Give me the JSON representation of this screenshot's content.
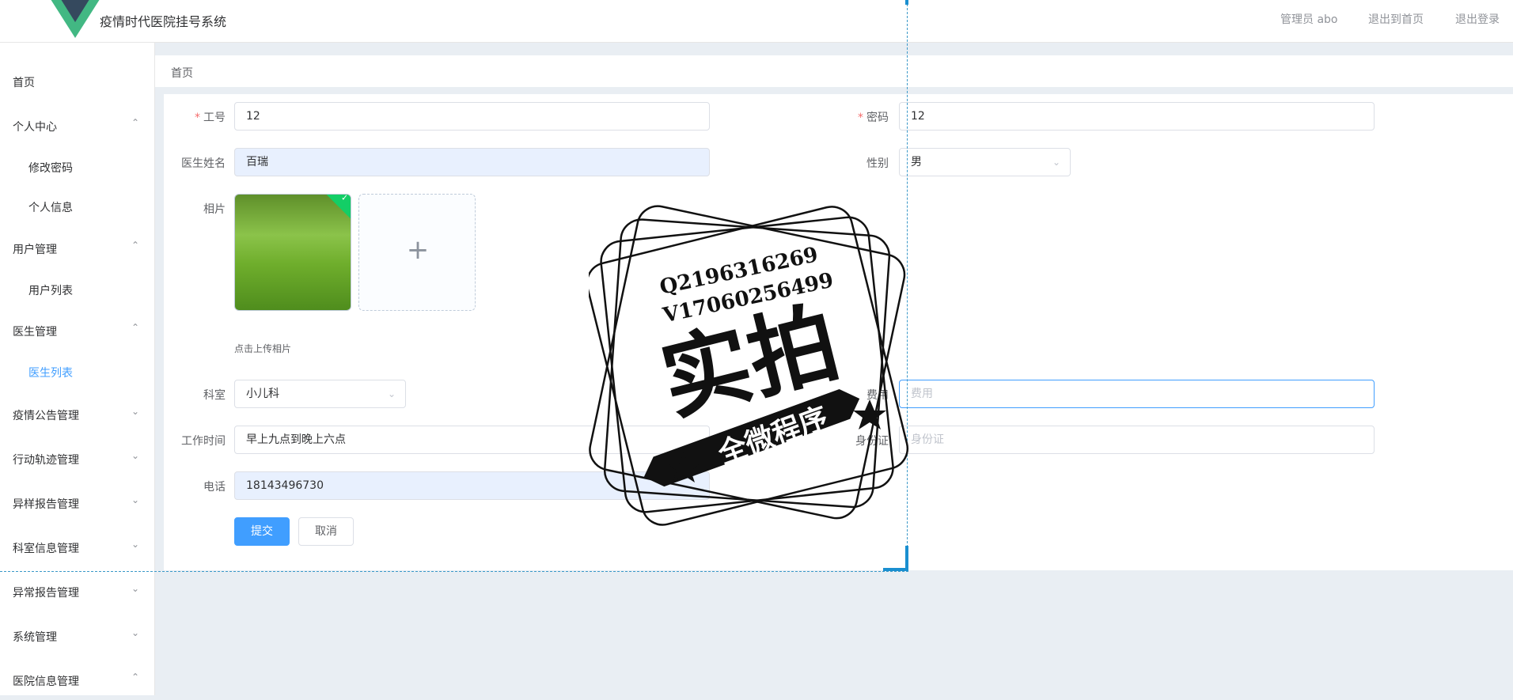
{
  "header": {
    "app_title": "疫情时代医院挂号系统",
    "admin_label": "管理员 abo",
    "back_home": "退出到首页",
    "logout": "退出登录"
  },
  "sidebar": {
    "items": [
      {
        "label": "首页",
        "type": "top",
        "arrow": ""
      },
      {
        "label": "个人中心",
        "type": "top",
        "arrow": "^"
      },
      {
        "label": "修改密码",
        "type": "sub",
        "arrow": ""
      },
      {
        "label": "个人信息",
        "type": "sub",
        "arrow": ""
      },
      {
        "label": "用户管理",
        "type": "top",
        "arrow": "^"
      },
      {
        "label": "用户列表",
        "type": "sub",
        "arrow": ""
      },
      {
        "label": "医生管理",
        "type": "top",
        "arrow": "^"
      },
      {
        "label": "医生列表",
        "type": "sub",
        "arrow": "",
        "active": true
      },
      {
        "label": "疫情公告管理",
        "type": "top",
        "arrow": "v"
      },
      {
        "label": "行动轨迹管理",
        "type": "top",
        "arrow": "v"
      },
      {
        "label": "异样报告管理",
        "type": "top",
        "arrow": "v"
      },
      {
        "label": "科室信息管理",
        "type": "top",
        "arrow": "v"
      },
      {
        "label": "异常报告管理",
        "type": "top",
        "arrow": "v"
      },
      {
        "label": "系统管理",
        "type": "top",
        "arrow": "v"
      },
      {
        "label": "医院信息管理",
        "type": "top",
        "arrow": "^"
      }
    ]
  },
  "breadcrumb": {
    "home": "首页"
  },
  "form": {
    "job_no": {
      "label": "工号",
      "value": "12"
    },
    "password": {
      "label": "密码",
      "value": "12"
    },
    "doctor_name": {
      "label": "医生姓名",
      "value": "百瑞"
    },
    "gender": {
      "label": "性别",
      "value": "男"
    },
    "photo": {
      "label": "相片",
      "hint": "点击上传相片",
      "plus": "+"
    },
    "department": {
      "label": "科室",
      "value": "小儿科"
    },
    "fee": {
      "label": "费用",
      "placeholder": "费用"
    },
    "work_time": {
      "label": "工作时间",
      "value": "早上九点到晚上六点"
    },
    "id_card": {
      "label": "身份证",
      "placeholder": "身份证"
    },
    "phone": {
      "label": "电话",
      "value": "18143496730"
    },
    "submit": "提交",
    "cancel": "取消"
  },
  "watermark": {
    "line1": "Q2196316269",
    "line2": "V17060256499",
    "main": "实拍",
    "banner": "全微程序"
  },
  "colors": {
    "primary": "#409eff",
    "required": "#f56c6c",
    "success": "#13ce66",
    "logo_green": "#42b883",
    "logo_dark": "#35495e"
  }
}
